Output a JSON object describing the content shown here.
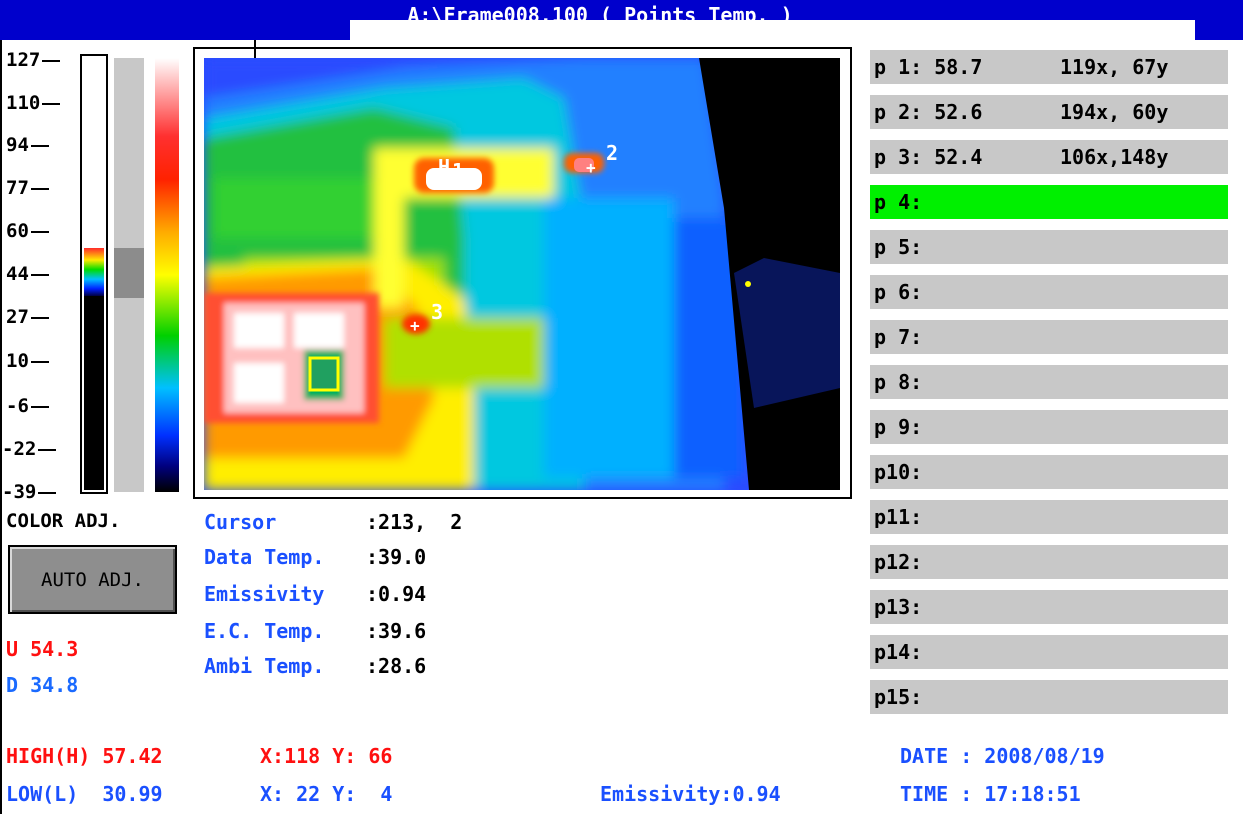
{
  "window": {
    "title": "A:\\Frame008.100 ( Points Temp. )"
  },
  "scale": {
    "ticks": [
      "127",
      "110",
      "94",
      "77",
      "60",
      "44",
      "27",
      "10",
      "-6",
      "-22",
      "-39"
    ]
  },
  "controls": {
    "color_adj": "COLOR ADJ.",
    "auto_adj": "AUTO ADJ.",
    "upper": "U 54.3",
    "lower": "D 34.8"
  },
  "thermal": {
    "markers": {
      "h": "H",
      "p1": "1",
      "p2": "2",
      "p3": "3"
    }
  },
  "info": {
    "cursor_label": "Cursor",
    "cursor_value": ":213,  2",
    "data_temp_label": "Data Temp.",
    "data_temp_value": ":39.0",
    "emissivity_label": "Emissivity",
    "emissivity_value": ":0.94",
    "ec_temp_label": "E.C. Temp.",
    "ec_temp_value": ":39.6",
    "ambi_temp_label": "Ambi Temp.",
    "ambi_temp_value": ":28.6"
  },
  "points": [
    {
      "label": "p 1: 58.7",
      "coord": "119x, 67y"
    },
    {
      "label": "p 2: 52.6",
      "coord": "194x, 60y"
    },
    {
      "label": "p 3: 52.4",
      "coord": "106x,148y"
    },
    {
      "label": "p 4:",
      "coord": ""
    },
    {
      "label": "p 5:",
      "coord": ""
    },
    {
      "label": "p 6:",
      "coord": ""
    },
    {
      "label": "p 7:",
      "coord": ""
    },
    {
      "label": "p 8:",
      "coord": ""
    },
    {
      "label": "p 9:",
      "coord": ""
    },
    {
      "label": "p10:",
      "coord": ""
    },
    {
      "label": "p11:",
      "coord": ""
    },
    {
      "label": "p12:",
      "coord": ""
    },
    {
      "label": "p13:",
      "coord": ""
    },
    {
      "label": "p14:",
      "coord": ""
    },
    {
      "label": "p15:",
      "coord": ""
    }
  ],
  "footer": {
    "high": "HIGH(H) 57.42",
    "high_xy": "X:118 Y: 66",
    "low": "LOW(L)  30.99",
    "low_xy": "X: 22 Y:  4",
    "emissivity": "Emissivity:0.94",
    "date": "DATE : 2008/08/19",
    "time": "TIME : 17:18:51"
  },
  "colors": {
    "title_bar": "#0000cc",
    "label_blue": "#1a50ff",
    "high_red": "#ff1010",
    "active_point": "#00f000",
    "point_row": "#c8c8c8"
  }
}
